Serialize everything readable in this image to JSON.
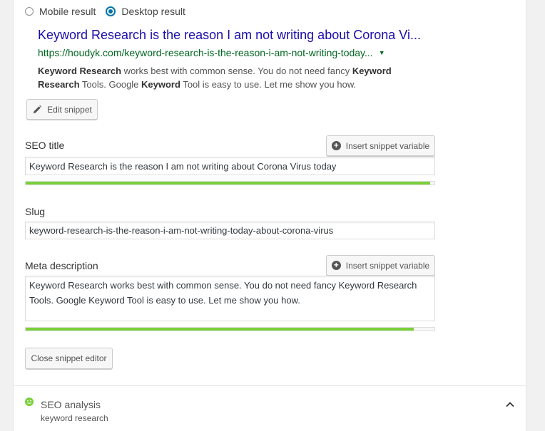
{
  "preview_mode": {
    "options": [
      {
        "label": "Mobile result",
        "checked": false
      },
      {
        "label": "Desktop result",
        "checked": true
      }
    ]
  },
  "snippet": {
    "title": "Keyword Research is the reason I am not writing about Corona Vi...",
    "url": "https://houdyk.com/keyword-research-is-the-reason-i-am-not-writing-today...",
    "desc_parts": {
      "p1": "Keyword Research",
      "p2": " works best with common sense. You do not need fancy ",
      "p3": "Keyword Research",
      "p4": " Tools. Google ",
      "p5": "Keyword",
      "p6": " Tool is easy to use. Let me show you how."
    }
  },
  "buttons": {
    "edit_snippet": "Edit snippet",
    "insert_variable": "Insert snippet variable",
    "close_editor": "Close snippet editor"
  },
  "fields": {
    "seo_title": {
      "label": "SEO title",
      "value": "Keyword Research is the reason I am not writing about Corona Virus today",
      "progress": 0.99
    },
    "slug": {
      "label": "Slug",
      "value": "keyword-research-is-the-reason-i-am-not-writing-today-about-corona-virus"
    },
    "meta_description": {
      "label": "Meta description",
      "value": "Keyword Research works best with common sense. You do not need fancy Keyword Research Tools. Google Keyword Tool is easy to use. Let me show you how.",
      "progress": 0.95
    }
  },
  "analysis": {
    "title": "SEO analysis",
    "keyphrase": "keyword research"
  },
  "colors": {
    "link_title": "#1a0dab",
    "url": "#006621",
    "progress_good": "#7ad03a",
    "radio_accent": "#0073aa"
  }
}
